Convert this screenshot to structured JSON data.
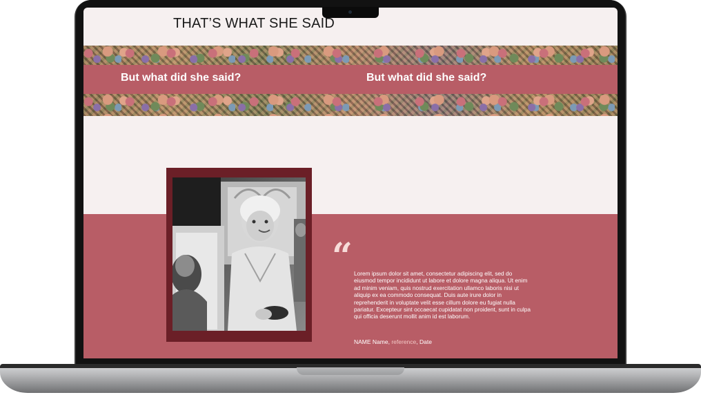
{
  "site": {
    "title": "THAT’S WHAT SHE SAID"
  },
  "banner": {
    "headings": [
      "But what did she said?",
      "But what did she said?"
    ]
  },
  "quote": {
    "mark": "“",
    "text": "Lorem ipsum dolor sit amet, consectetur adipiscing elit, sed do eiusmod tempor incididunt ut labore et dolore magna aliqua. Ut enim ad minim veniam, quis nostrud exercitation ullamco laboris nisi ut aliquip ex ea commodo consequat. Duis aute irure dolor in reprehenderit in voluptate velit esse cillum dolore eu fugiat nulla pariatur. Excepteur sint occaecat cupidatat non proident, sunt in culpa qui officia deserunt mollit anim id est laborum.",
    "name": "NAME Name,",
    "reference": "reference",
    "date": ", Date"
  },
  "colors": {
    "accent": "#b85d66",
    "frame": "#6b1f27",
    "background": "#f6f0f0",
    "quote_mark": "#f7dcd9"
  }
}
